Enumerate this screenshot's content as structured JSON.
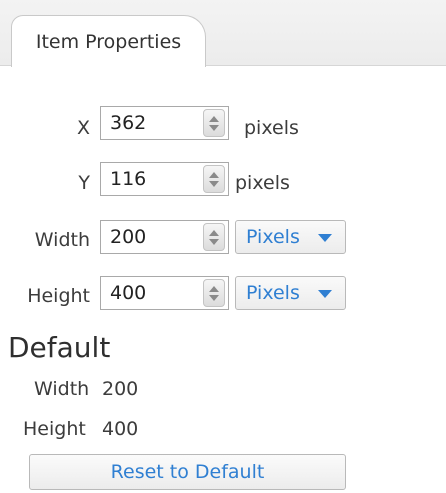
{
  "tab": {
    "label": "Item Properties"
  },
  "position": {
    "x": {
      "label": "X",
      "value": "362",
      "unit": "pixels"
    },
    "y": {
      "label": "Y",
      "value": "116",
      "unit": "pixels"
    }
  },
  "size": {
    "width": {
      "label": "Width",
      "value": "200",
      "unit": "Pixels"
    },
    "height": {
      "label": "Height",
      "value": "400",
      "unit": "Pixels"
    }
  },
  "default": {
    "title": "Default",
    "width_label": "Width",
    "width_value": "200",
    "height_label": "Height",
    "height_value": "400",
    "reset_label": "Reset to Default"
  },
  "colors": {
    "link_blue": "#2f7fd2",
    "border": "#a9a9a9"
  },
  "icons": {
    "spinner": "spinner-arrows-icon",
    "dropdown": "caret-down-icon"
  }
}
